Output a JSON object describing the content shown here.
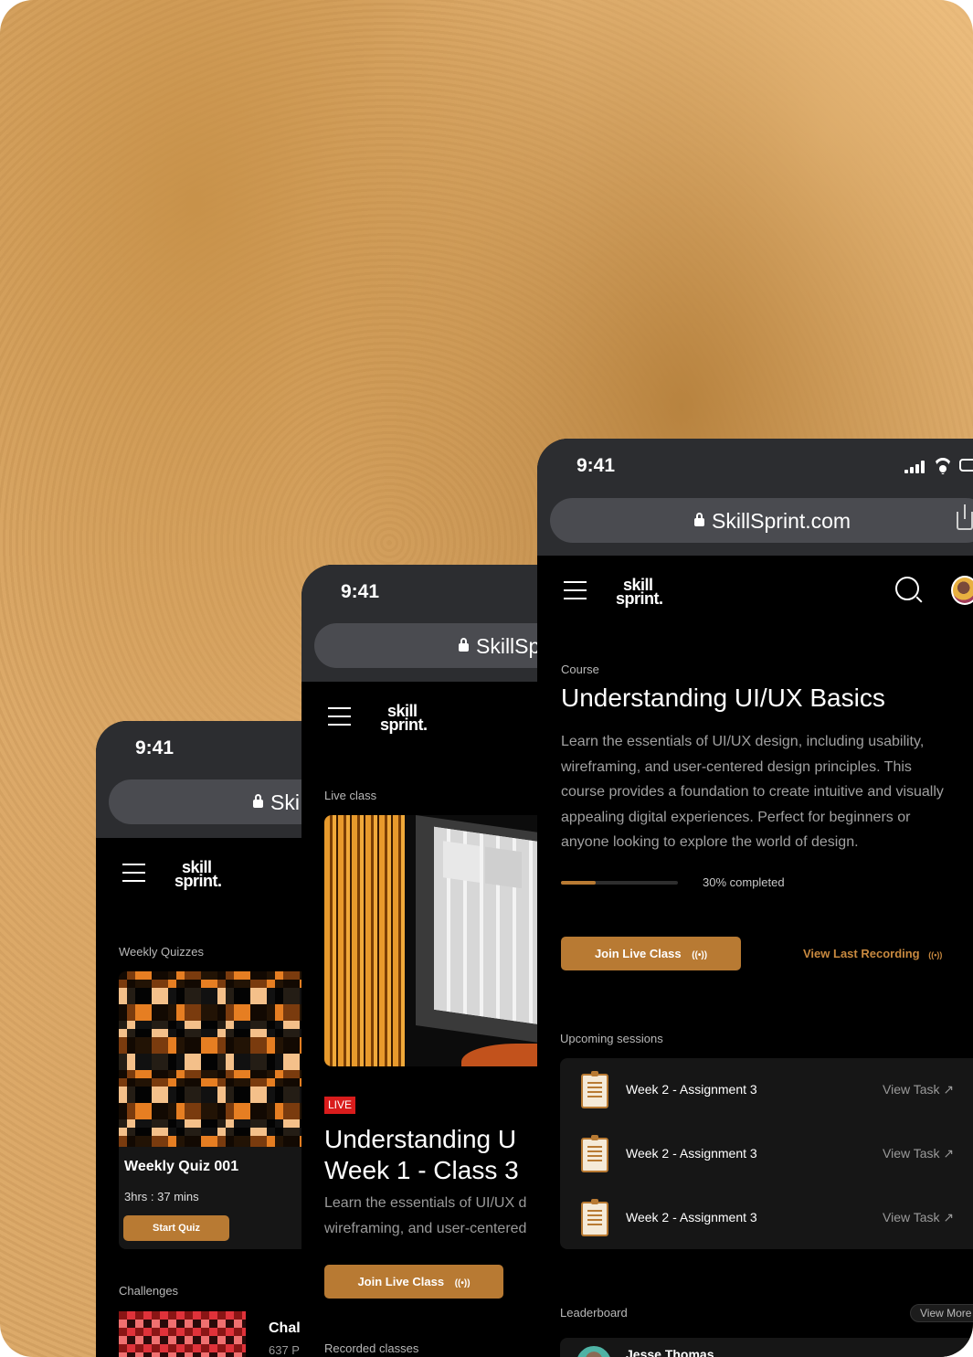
{
  "colors": {
    "accent": "#b87a33",
    "background": "#000000",
    "status_bar": "#2c2d30",
    "url_bar": "#4a4b50"
  },
  "phones": {
    "back": {
      "time": "9:41",
      "url": "Ski",
      "logo_top": "skill",
      "logo_bottom": "sprint.",
      "weekly_quizzes_label": "Weekly Quizzes",
      "quiz_title": "Weekly Quiz 001",
      "quiz_duration": "3hrs : 37 mins",
      "start_quiz": "Start Quiz",
      "challenges_label": "Challenges",
      "challenge_title": "Chal",
      "challenge_meta": "637 P"
    },
    "middle": {
      "time": "9:41",
      "url": "SkillSp",
      "logo_top": "skill",
      "logo_bottom": "sprint.",
      "live_class_label": "Live class",
      "live_badge": "LIVE",
      "title_line1": "Understanding U",
      "title_line2": "Week 1 - Class 3",
      "desc_line1": "Learn the essentials of UI/UX d",
      "desc_line2": "wireframing, and user-centered",
      "join_button": "Join Live Class",
      "recorded_label": "Recorded classes"
    },
    "front": {
      "time": "9:41",
      "url": "SkillSprint.com",
      "logo_top": "skill",
      "logo_bottom": "sprint.",
      "course_label": "Course",
      "course_title": "Understanding UI/UX Basics",
      "desc_lines": [
        "Learn the essentials of UI/UX design, including usability,",
        "wireframing, and user-centered design principles. This",
        "course provides a foundation to create intuitive and visually",
        "appealing digital experiences. Perfect for beginners or",
        "anyone looking to explore the world of design."
      ],
      "progress_fraction": 0.3,
      "progress_text": "30% completed",
      "join_button": "Join Live Class",
      "view_recording": "View Last Recording",
      "upcoming_label": "Upcoming sessions",
      "sessions": [
        {
          "title": "Week 2 - Assignment 3",
          "action": "View Task"
        },
        {
          "title": "Week 2 - Assignment 3",
          "action": "View Task"
        },
        {
          "title": "Week 2 - Assignment 3",
          "action": "View Task"
        }
      ],
      "leaderboard_label": "Leaderboard",
      "view_more": "View More",
      "leader_name": "Jesse Thomas"
    }
  }
}
